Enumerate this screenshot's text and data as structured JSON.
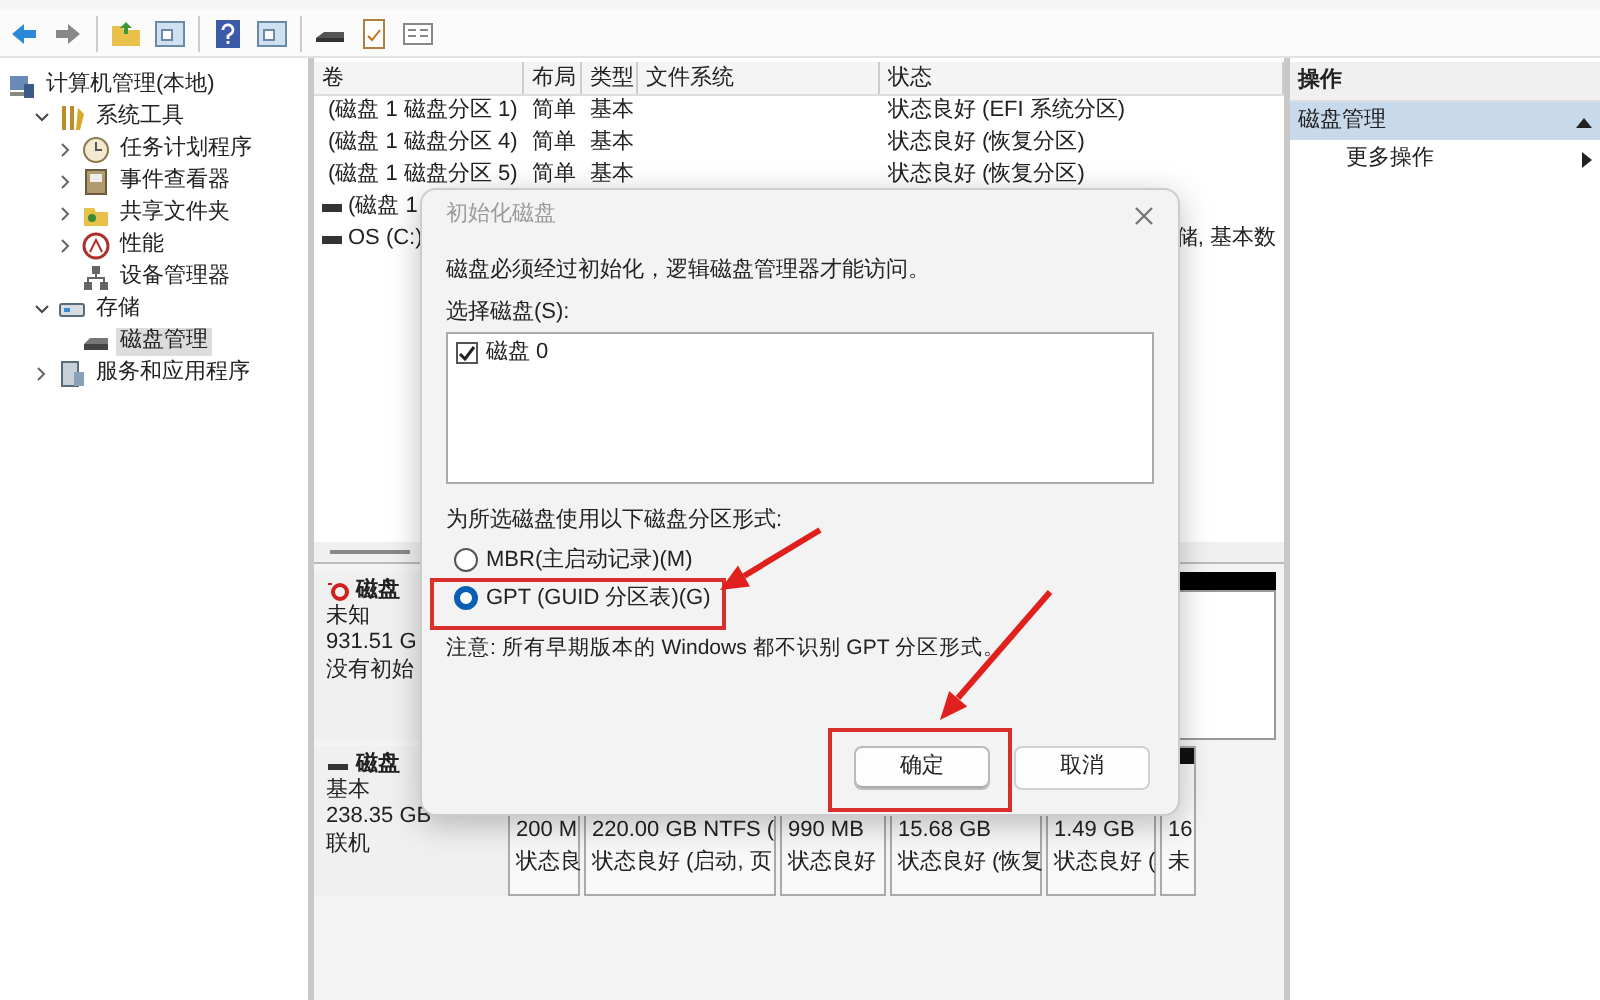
{
  "tree": [
    {
      "label": "计算机管理(本地)",
      "kind": "computer",
      "selected": false,
      "children": [
        {
          "label": "系统工具",
          "kind": "tools",
          "expanded": true,
          "selected": false,
          "children": [
            {
              "label": "任务计划程序",
              "kind": "clock",
              "expanded": false,
              "selected": false
            },
            {
              "label": "事件查看器",
              "kind": "viewer",
              "expanded": false,
              "selected": false
            },
            {
              "label": "共享文件夹",
              "kind": "folder",
              "expanded": false,
              "selected": false
            },
            {
              "label": "性能",
              "kind": "perf",
              "expanded": false,
              "selected": false
            },
            {
              "label": "设备管理器",
              "kind": "device",
              "selected": false
            }
          ]
        },
        {
          "label": "存储",
          "kind": "storage",
          "expanded": true,
          "selected": false,
          "children": [
            {
              "label": "磁盘管理",
              "kind": "disk",
              "selected": true
            }
          ]
        },
        {
          "label": "服务和应用程序",
          "kind": "services",
          "expanded": false,
          "selected": false
        }
      ]
    }
  ],
  "volumes": {
    "columns": [
      "卷",
      "布局",
      "类型",
      "文件系统",
      "状态"
    ],
    "rows": [
      {
        "volume": "(磁盘 1 磁盘分区 1)",
        "layout": "简单",
        "type": "基本",
        "status": "状态良好 (EFI 系统分区)"
      },
      {
        "volume": "(磁盘 1 磁盘分区 4)",
        "layout": "简单",
        "type": "基本",
        "status": "状态良好 (恢复分区)"
      },
      {
        "volume": "(磁盘 1 磁盘分区 5)",
        "layout": "简单",
        "type": "基本",
        "status": "状态良好 (恢复分区)"
      },
      {
        "volume": "(磁盘 1"
      },
      {
        "volume": "OS (C:)",
        "status": "储, 基本数",
        "covered": true
      }
    ]
  },
  "disks": [
    {
      "kind": "unknown",
      "name": "磁盘",
      "lines": [
        "未知",
        "931.51 G",
        "没有初始"
      ]
    },
    {
      "kind": "basic",
      "name": "磁盘",
      "lines": [
        "基本",
        "238.35 GB",
        "联机"
      ],
      "partitions": [
        {
          "size": "200 M",
          "status": "状态良"
        },
        {
          "size": "220.00 GB NTFS (",
          "status": "状态良好 (启动, 页"
        },
        {
          "size": "990 MB",
          "status": "状态良好"
        },
        {
          "size": "15.68 GB",
          "status": "状态良好 (恢复"
        },
        {
          "size": "1.49 GB",
          "status": "状态良好 ("
        },
        {
          "size": "16",
          "status": "未"
        }
      ]
    }
  ],
  "actions": {
    "title": "操作",
    "section": {
      "label": "磁盘管理",
      "expanded": true
    },
    "items": [
      "更多操作"
    ]
  },
  "dialog": {
    "title": "初始化磁盘",
    "message": "磁盘必须经过初始化，逻辑磁盘管理器才能访问。",
    "list_label": "选择磁盘(S):",
    "disks": [
      {
        "label": "磁盘 0",
        "checked": true
      }
    ],
    "style_label": "为所选磁盘使用以下磁盘分区形式:",
    "styles": [
      {
        "label": "MBR(主启动记录)(M)",
        "selected": false
      },
      {
        "label": "GPT (GUID 分区表)(G)",
        "selected": true
      }
    ],
    "note": "注意: 所有早期版本的 Windows 都不识别 GPT 分区形式。",
    "buttons": [
      {
        "label": "确定",
        "kind": "default"
      },
      {
        "label": "取消",
        "kind": "normal"
      }
    ]
  }
}
